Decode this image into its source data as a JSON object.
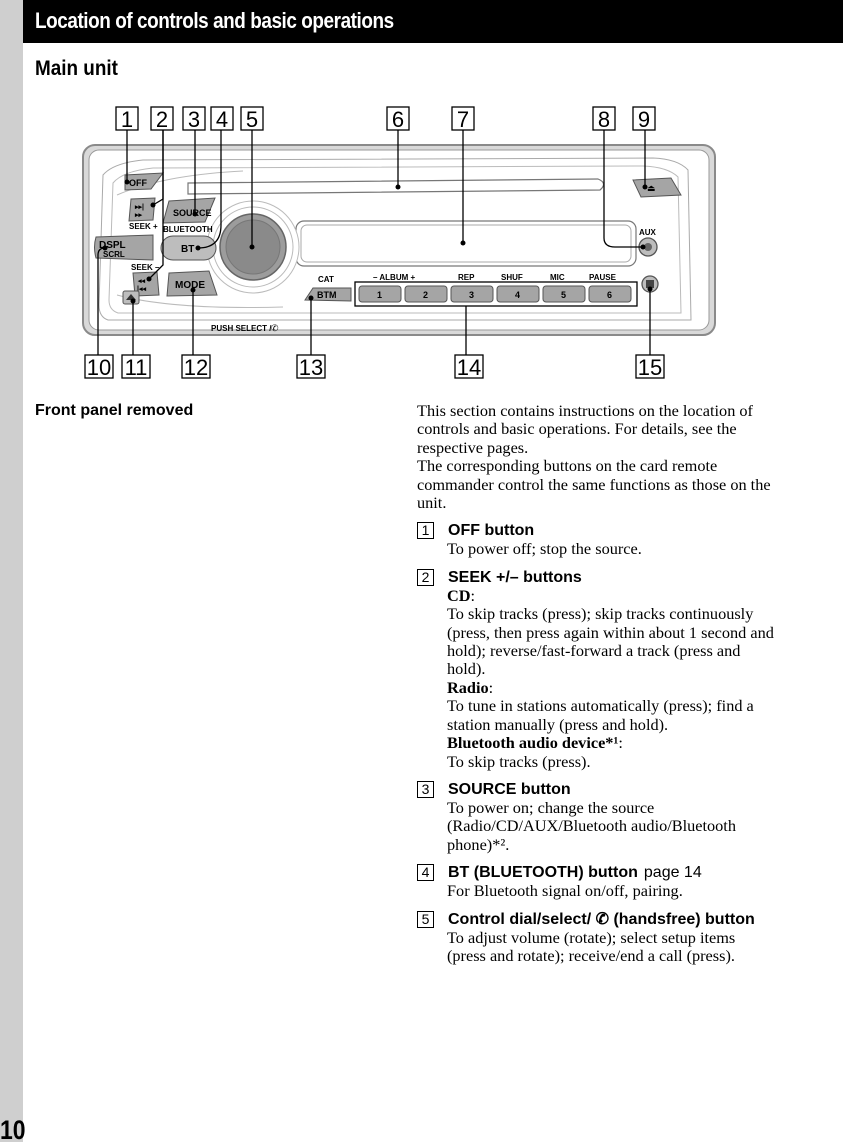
{
  "header": {
    "title": "Location of controls and basic operations"
  },
  "section_title": "Main unit",
  "diagram": {
    "callouts": [
      "1",
      "2",
      "3",
      "4",
      "5",
      "6",
      "7",
      "8",
      "9",
      "10",
      "11",
      "12",
      "13",
      "14",
      "15"
    ],
    "buttons": {
      "off": "OFF",
      "source": "SOURCE",
      "dspl": "DSPL",
      "scrl": "SCRL",
      "bt": "BT",
      "mode": "MODE",
      "btm": "BTM",
      "eject": "⏏",
      "aux": "AUX",
      "seek_plus": "SEEK +",
      "seek_minus": "SEEK –",
      "bluetooth": "BLUETOOTH",
      "push_select": "PUSH SELECT /",
      "cat": "CAT",
      "album": "–  ALBUM  +",
      "rep": "REP",
      "shuf": "SHUF",
      "mic": "MIC",
      "pause": "PAUSE",
      "presets": [
        "1",
        "2",
        "3",
        "4",
        "5",
        "6"
      ]
    }
  },
  "front_panel_title": "Front panel removed",
  "intro": [
    "This section contains instructions on the location of controls and basic operations. For details, see the respective pages.",
    "The corresponding buttons on the card remote commander control the same functions as those on the unit."
  ],
  "items": [
    {
      "num": "1",
      "title": "OFF button",
      "body": "To power off; stop the source."
    },
    {
      "num": "2",
      "title": "SEEK +/– buttons",
      "cd_label": "CD",
      "cd_text": "To skip tracks (press); skip tracks continuously (press, then press again within about 1 second and hold); reverse/fast-forward a track (press and hold).",
      "radio_label": "Radio",
      "radio_text": "To tune in stations automatically (press); find a station manually (press and hold).",
      "bt_label": "Bluetooth audio device*¹",
      "bt_text": "To skip tracks (press)."
    },
    {
      "num": "3",
      "title": "SOURCE button",
      "body": "To power on; change the source (Radio/CD/AUX/Bluetooth audio/Bluetooth phone)*²."
    },
    {
      "num": "4",
      "title": "BT (BLUETOOTH) button",
      "page_ref": "page 14",
      "body": "For Bluetooth signal on/off, pairing."
    },
    {
      "num": "5",
      "title_a": "Control dial/select/",
      "title_b": "(handsfree) button",
      "body": "To adjust volume (rotate); select setup items (press and rotate); receive/end a call (press)."
    }
  ],
  "page_number": "10"
}
